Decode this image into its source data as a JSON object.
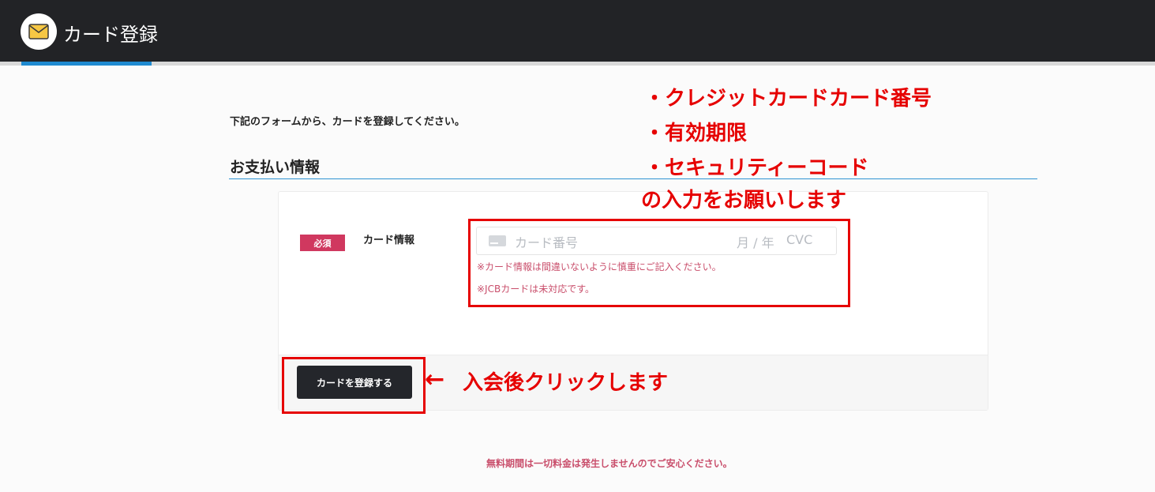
{
  "header": {
    "title": "カード登録",
    "logo_icon": "envelope-icon",
    "accent_color": "#1f8ad0"
  },
  "main": {
    "intro_text": "下記のフォームから、カードを登録してください。",
    "section_title": "お支払い情報",
    "required_badge": "必須",
    "field_label": "カード情報",
    "card_input": {
      "card_icon": "credit-card-icon",
      "number_placeholder": "カード番号",
      "expiry_placeholder": "月 / 年",
      "cvc_placeholder": "CVC"
    },
    "notes": [
      "※カード情報は間違いないように慎重にご記入ください。",
      "※JCBカードは未対応です。"
    ],
    "submit_label": "カードを登録する",
    "free_period_note": "無料期間は一切料金は発生しませんのでご安心ください。"
  },
  "annotations": {
    "lines": [
      "・クレジットカードカード番号",
      "・有効期限",
      "・セキュリティーコード",
      "の入力をお願いします"
    ],
    "arrow": "←",
    "click_note": "入会後クリックします",
    "highlight_color": "#e60000"
  }
}
